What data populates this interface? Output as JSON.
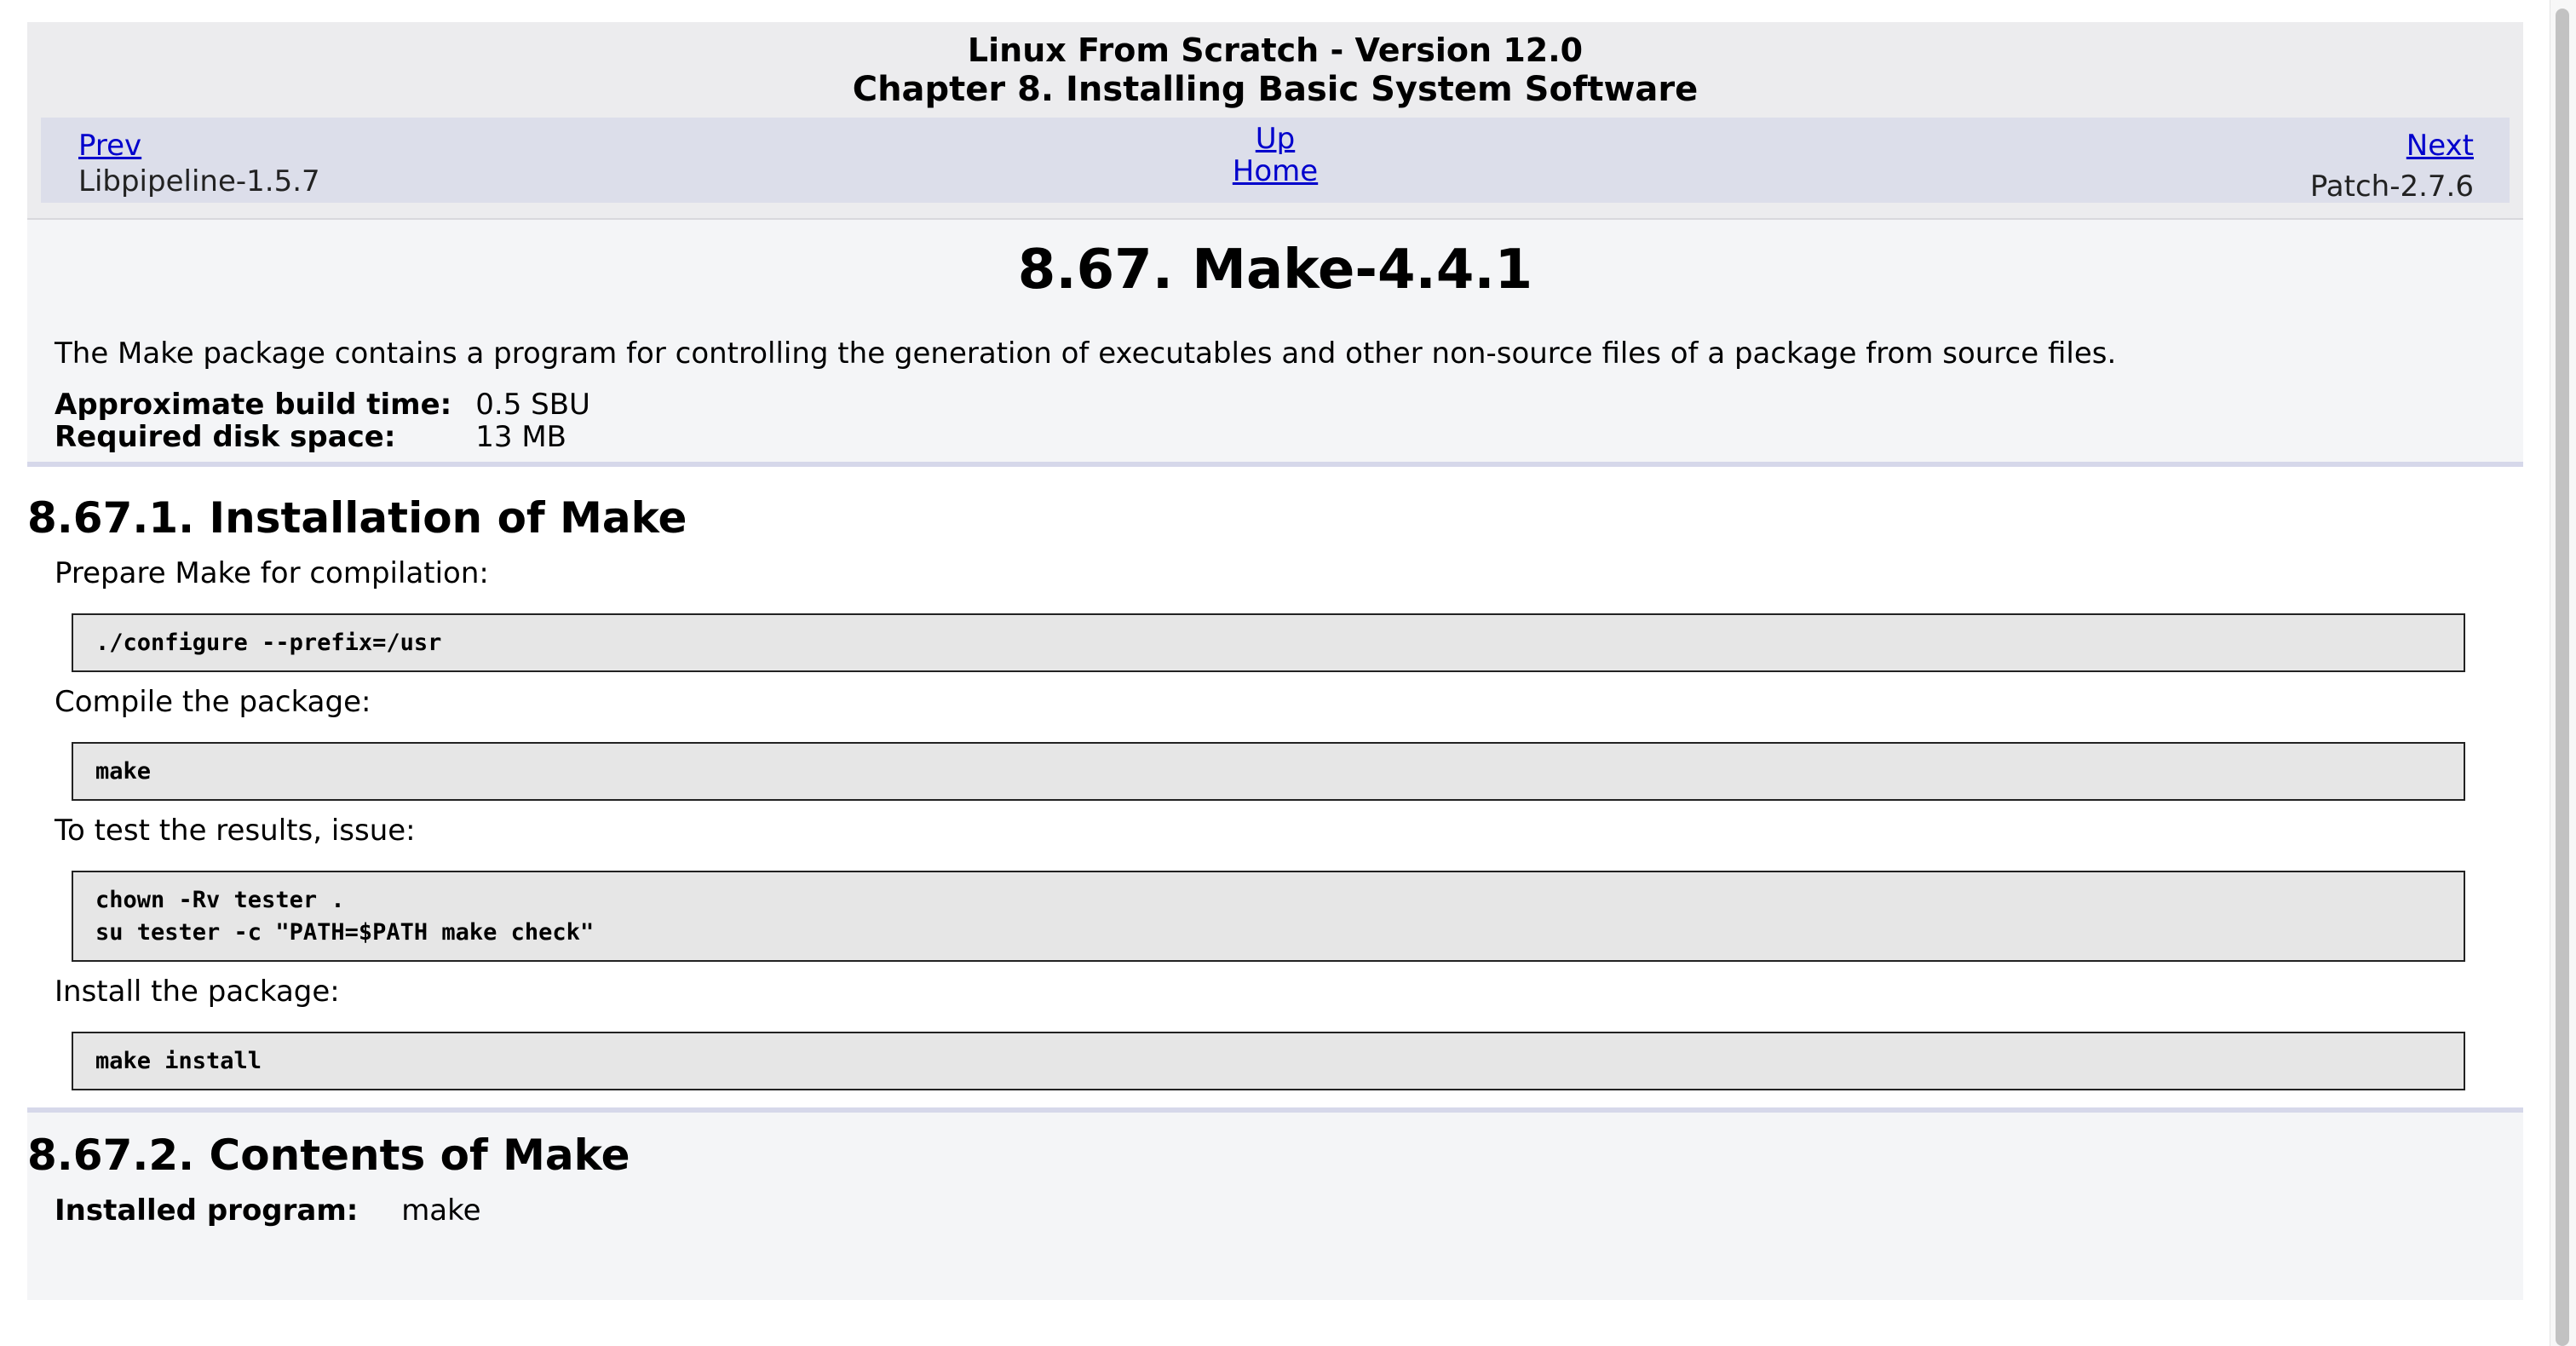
{
  "header": {
    "book_title": "Linux From Scratch - Version 12.0",
    "chapter_title": "Chapter 8. Installing Basic System Software"
  },
  "nav": {
    "prev_label": "Prev",
    "prev_title": "Libpipeline-1.5.7",
    "up_label": "Up",
    "home_label": "Home",
    "next_label": "Next",
    "next_title": "Patch-2.7.6"
  },
  "package": {
    "title": "8.67. Make-4.4.1",
    "intro": "The Make package contains a program for controlling the generation of executables and other non-source files of a package from source files.",
    "build_time_label": "Approximate build time:",
    "build_time_value": "0.5 SBU",
    "disk_space_label": "Required disk space:",
    "disk_space_value": "13 MB"
  },
  "installation": {
    "heading": "8.67.1. Installation of Make",
    "prepare_text": "Prepare Make for compilation:",
    "configure_cmd": "./configure --prefix=/usr",
    "compile_text": "Compile the package:",
    "compile_cmd": "make",
    "test_text": "To test the results, issue:",
    "test_cmd_1": "chown -Rv tester .",
    "test_cmd_2": "su tester -c \"PATH=$PATH make check\"",
    "install_text": "Install the package:",
    "install_cmd": "make install"
  },
  "contents": {
    "heading": "8.67.2. Contents of Make",
    "installed_program_label": "Installed program:",
    "installed_program_value": "make"
  }
}
